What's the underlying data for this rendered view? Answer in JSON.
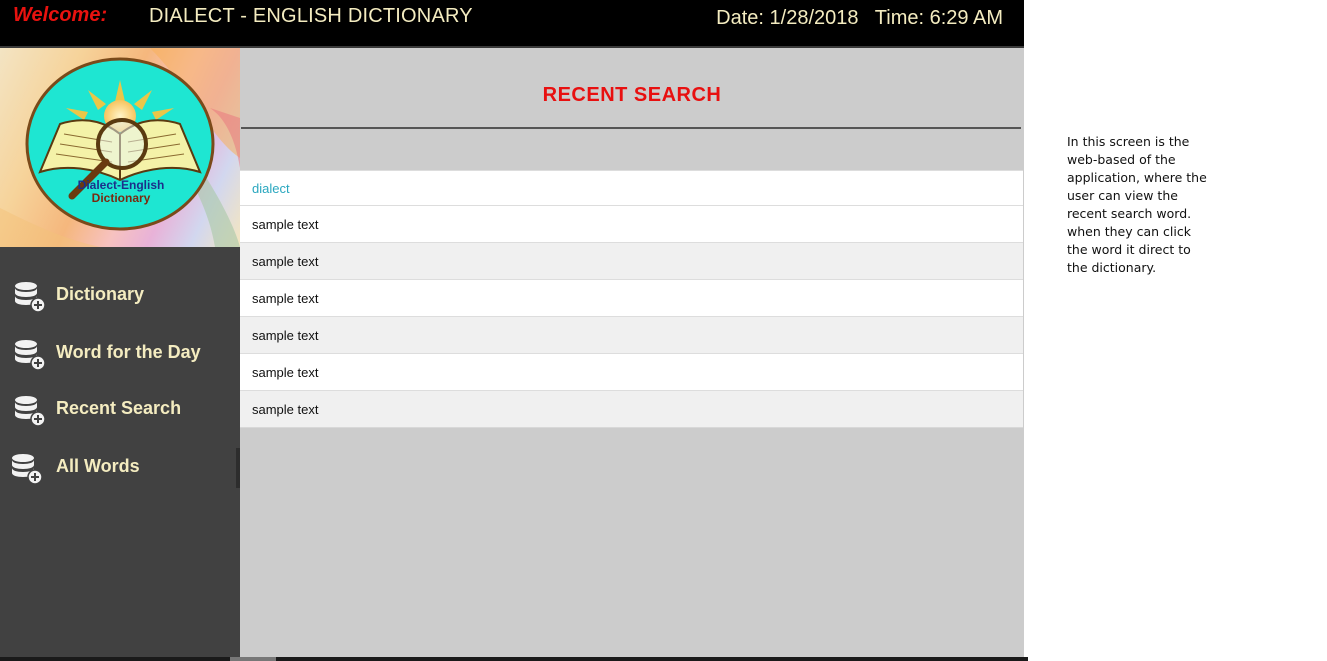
{
  "header": {
    "welcome": "Welcome:",
    "title": "DIALECT - ENGLISH DICTIONARY",
    "datetime": "Date: 1/28/2018   Time: 6:29 AM"
  },
  "logo": {
    "line1": "Dialect-English",
    "line2": "Dictionary"
  },
  "nav": {
    "items": [
      {
        "label": "Dictionary",
        "icon": "database-add-icon"
      },
      {
        "label": "Word for the Day",
        "icon": "database-add-icon"
      },
      {
        "label": "Recent Search",
        "icon": "database-add-icon"
      },
      {
        "label": "All Words",
        "icon": "database-add-icon"
      }
    ]
  },
  "main": {
    "heading": "RECENT SEARCH",
    "rows": [
      "dialect",
      "sample text",
      "sample text",
      "sample text",
      "sample text",
      "sample text",
      "sample text"
    ]
  },
  "note": "In this screen is the web-based of the application, where the user can view the recent search word. when they can click the word it direct to the dictionary.",
  "colors": {
    "welcome": "#e8120f",
    "heading": "#e81010",
    "nav_text": "#f4ecc0",
    "link": "#2aa7bf",
    "sidebar": "#414141",
    "main_bg": "#cccccc"
  }
}
